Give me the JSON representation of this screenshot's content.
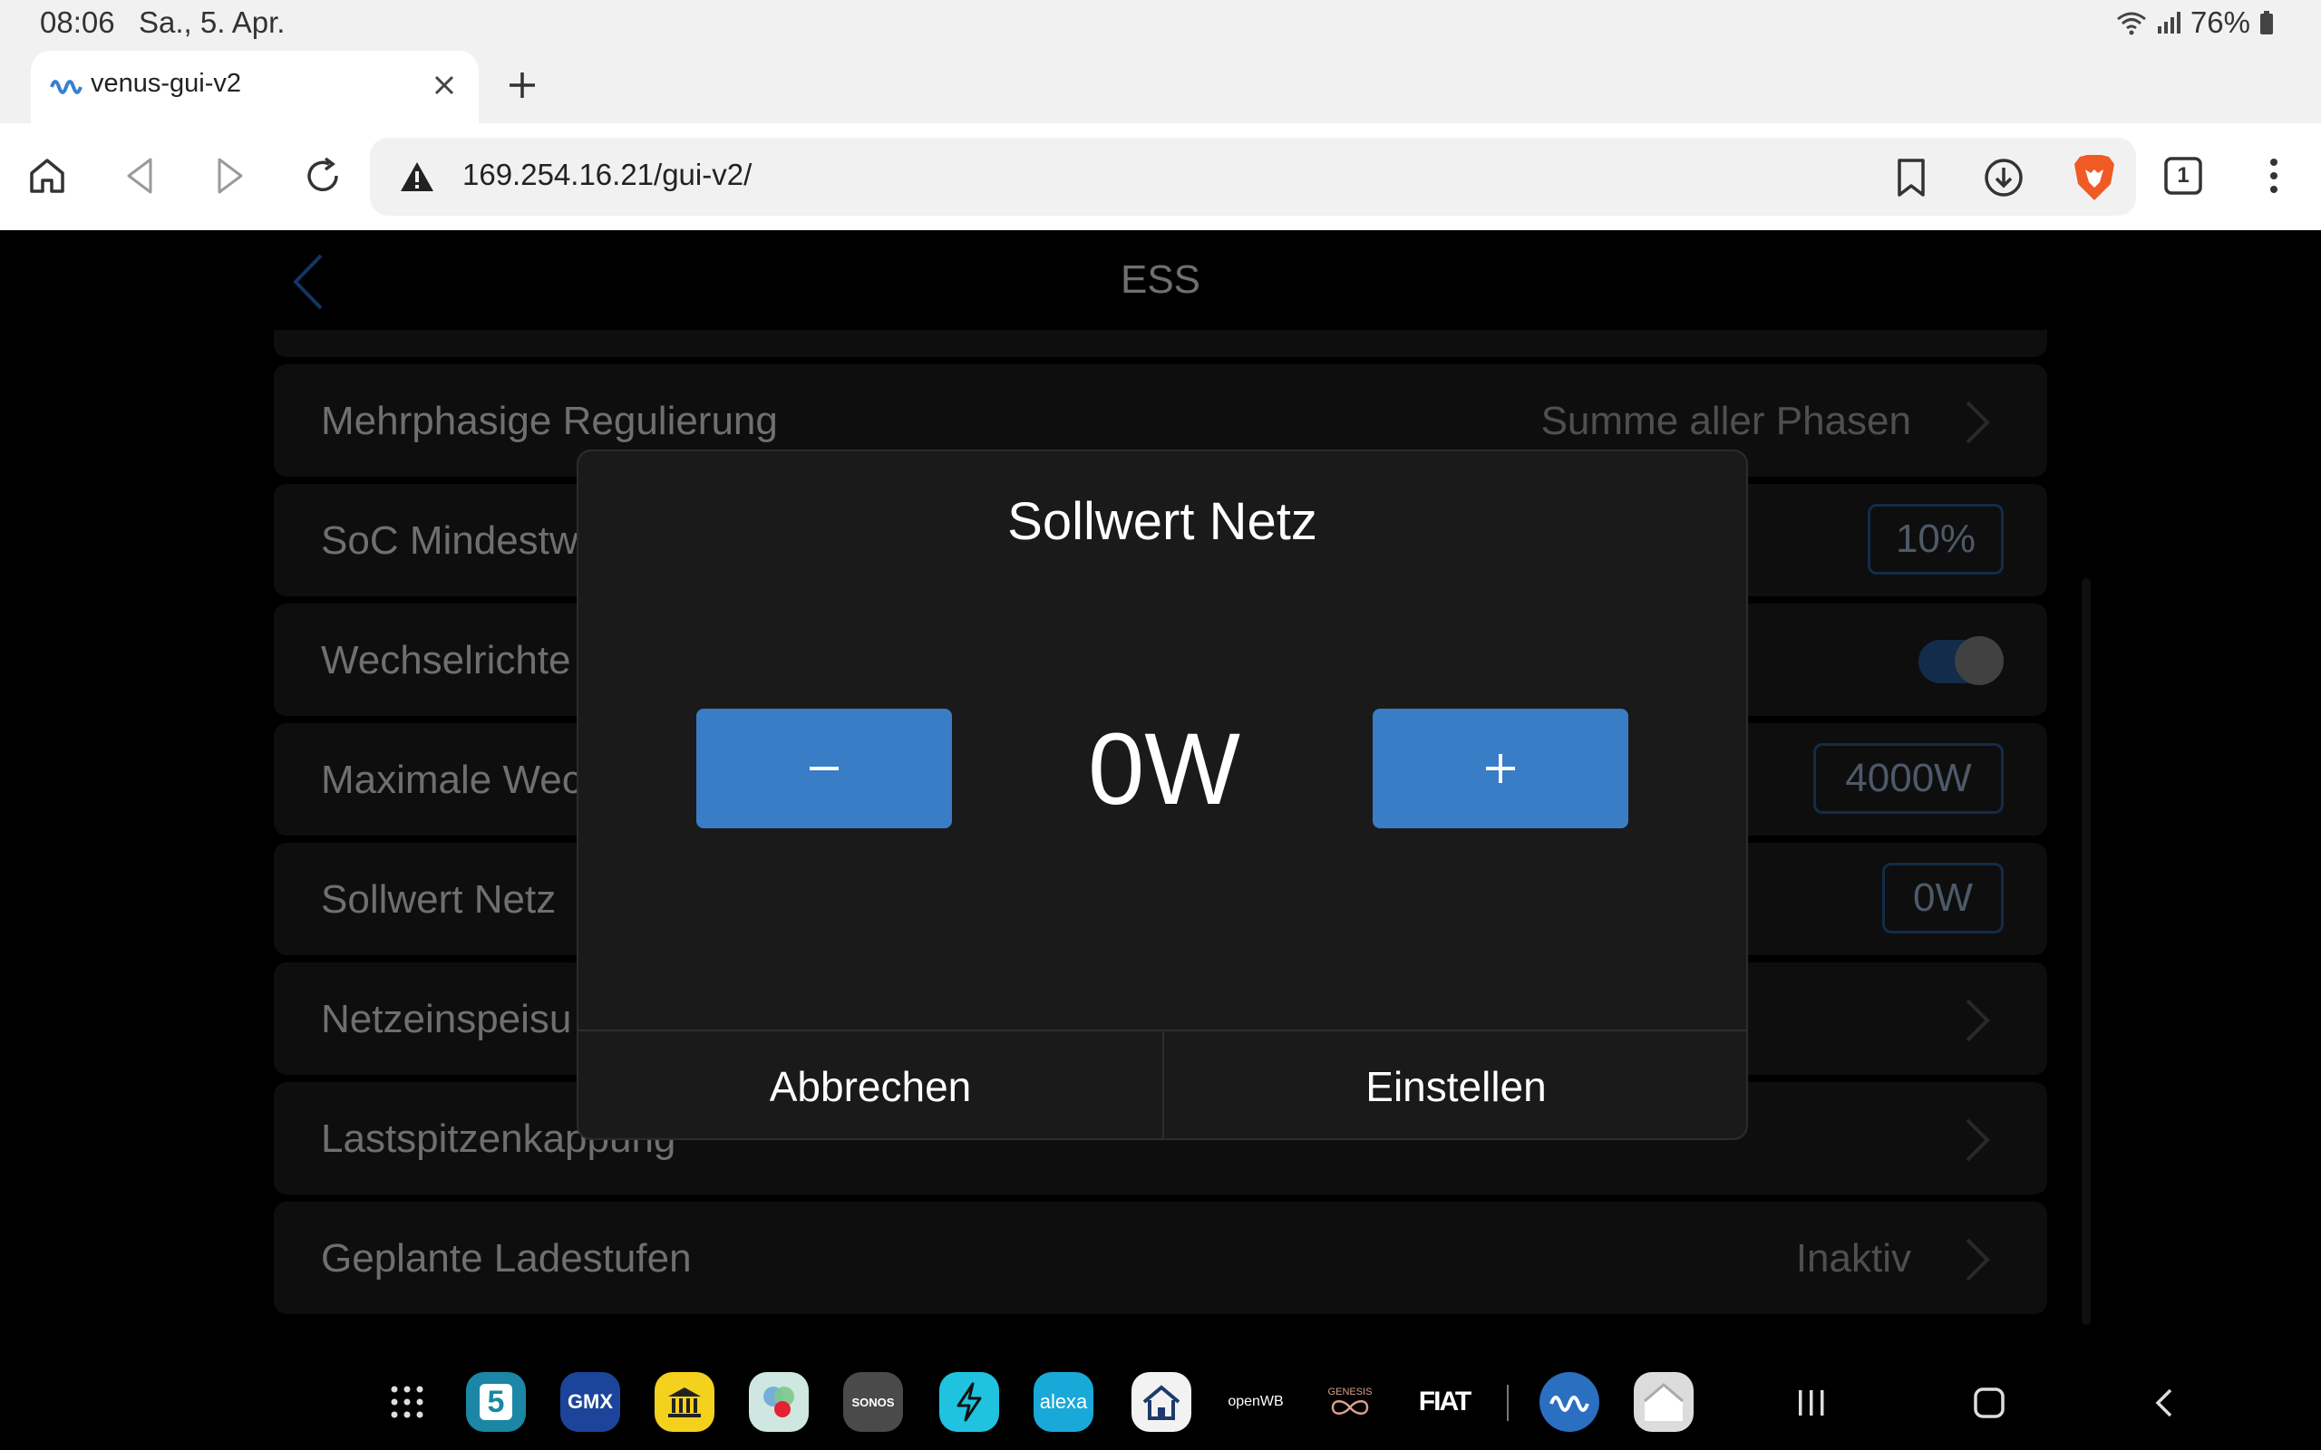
{
  "status_bar": {
    "time": "08:06",
    "date": "Sa., 5. Apr.",
    "battery": "76%"
  },
  "browser": {
    "tab_title": "venus-gui-v2",
    "url": "169.254.16.21/gui-v2/",
    "tab_count": "1"
  },
  "page": {
    "title": "ESS",
    "rows": [
      {
        "label": "Mehrphasige Regulierung",
        "value": "Summe aller Phasen"
      },
      {
        "label": "SoC Mindestw",
        "value": "10%"
      },
      {
        "label": "Wechselrichte"
      },
      {
        "label": "Maximale Wec",
        "value": "4000W"
      },
      {
        "label": "Sollwert Netz",
        "value": "0W"
      },
      {
        "label": "Netzeinspeisu"
      },
      {
        "label": "Lastspitzenkappung"
      },
      {
        "label": "Geplante Ladestufen",
        "value": "Inaktiv"
      }
    ]
  },
  "dialog": {
    "title": "Sollwert Netz",
    "value": "0W",
    "cancel_label": "Abbrechen",
    "confirm_label": "Einstellen"
  },
  "taskbar": {
    "apps": [
      {
        "name": "apps-grid",
        "label": ""
      },
      {
        "name": "calendar",
        "label": "5"
      },
      {
        "name": "gmx",
        "label": "GMX"
      },
      {
        "name": "museum-app",
        "label": ""
      },
      {
        "name": "circles-app",
        "label": ""
      },
      {
        "name": "sonos",
        "label": "SONOS"
      },
      {
        "name": "lightning-app",
        "label": ""
      },
      {
        "name": "alexa",
        "label": "alexa"
      },
      {
        "name": "home-app",
        "label": ""
      },
      {
        "name": "openwb",
        "label": "openWB"
      },
      {
        "name": "genesis",
        "label": "GENESIS"
      },
      {
        "name": "fiat",
        "label": "FIAT"
      },
      {
        "name": "victron",
        "label": ""
      },
      {
        "name": "smart-home",
        "label": ""
      }
    ]
  },
  "colors": {
    "accent": "#387dc5",
    "dialog_bg": "#1a1a1a",
    "row_bg": "#141414",
    "box_border": "#1b3d66"
  }
}
